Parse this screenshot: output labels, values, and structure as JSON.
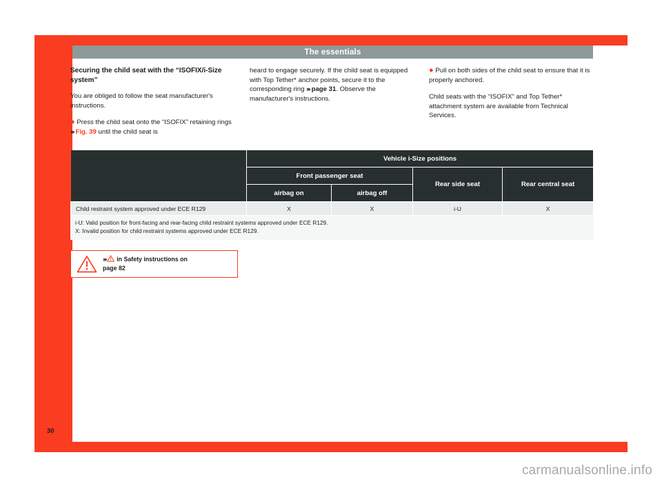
{
  "header": {
    "title": "The essentials",
    "bar_color": "#8d9a99"
  },
  "page": {
    "number": "30",
    "frame_color": "#fa3c20"
  },
  "content": {
    "heading": "Securing the child seat with the “ISOFIX/i-Size system”",
    "para_1": "You are obliged to follow the seat manufacturer's instructions.",
    "bullet_1_part1": "Press the child seat onto the “ISOFIX” retaining rings ",
    "bullet_1_ref": "Fig. 39",
    "bullet_1_part2": " until the child seat is heard to engage securely. If the child seat is equipped with Top Tether* anchor points, secure it to the corresponding ring ",
    "page_ref": "page 31",
    "bullet_1_part3": ". Observe the manufacturer's instructions.",
    "bullet_2": "Pull on both sides of the child seat to ensure that it is properly anchored.",
    "para_2": "Child seats with the “ISOFIX” and Top Tether* attachment system are available from Technical Services."
  },
  "table": {
    "group_header": "Vehicle i-Size positions",
    "front_passenger_header": "Front passenger seat",
    "sub_headers": [
      "airbag on",
      "airbag off"
    ],
    "rear_side_header": "Rear side seat",
    "rear_central_header": "Rear central seat",
    "rows": [
      {
        "label": "Child restraint system approved under ECE R129",
        "values": [
          "X",
          "X",
          "i-U",
          "X"
        ]
      }
    ],
    "footnotes": [
      "i-U: Valid position for front-facing and rear-facing child restraint systems approved under ECE R129.",
      "X: Invalid position for child restraint systems approved under ECE R129."
    ]
  },
  "warning": {
    "prefix": "›››",
    "text_line1": " in Safety instructions on",
    "text_line2": "page 82"
  },
  "watermark": "carmanualsonline.info"
}
